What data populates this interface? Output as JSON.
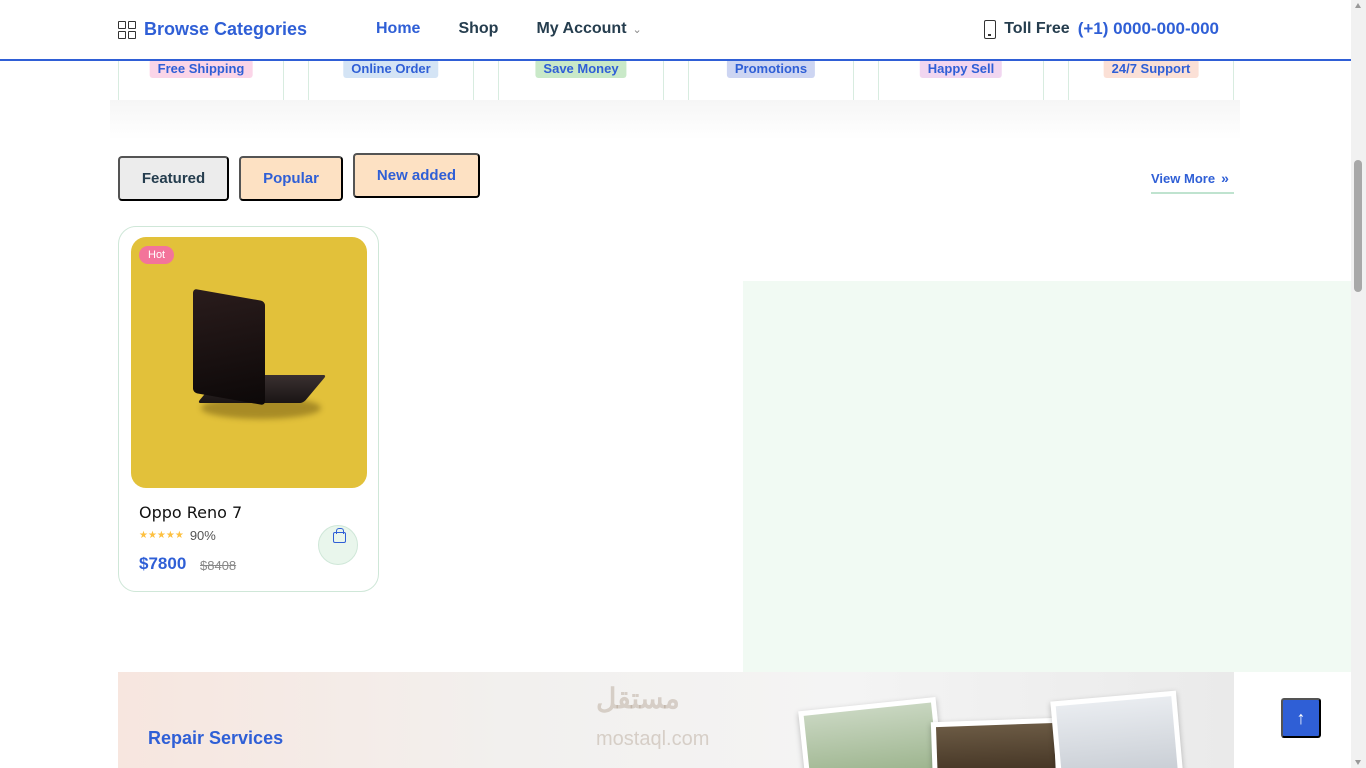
{
  "header": {
    "browse_label": "Browse Categories",
    "nav": [
      {
        "label": "Home"
      },
      {
        "label": "Shop"
      },
      {
        "label": "My Account"
      }
    ],
    "toll_free_label": "Toll Free",
    "toll_free_number": "(+1) 0000-000-000"
  },
  "features": [
    {
      "label": "Free Shipping",
      "color": "#fbd5e8"
    },
    {
      "label": "Online Order",
      "color": "#d4e4f5"
    },
    {
      "label": "Save Money",
      "color": "#c9e9c8"
    },
    {
      "label": "Promotions",
      "color": "#cdd5f2"
    },
    {
      "label": "Happy Sell",
      "color": "#f1d6f0"
    },
    {
      "label": "24/7 Support",
      "color": "#fbe0d6"
    }
  ],
  "tabs": {
    "featured": "Featured",
    "popular": "Popular",
    "new_added": "New added",
    "view_more": "View More"
  },
  "product": {
    "badge": "Hot",
    "name": "Oppo Reno 7",
    "stars": "★★★★★",
    "rating": "90%",
    "price": "$7800",
    "old_price": "$8408"
  },
  "banner": {
    "title": "Repair Services",
    "watermark": "مستقل",
    "watermark_sub": "mostaql.com"
  },
  "colors": {
    "accent": "#2f5fd6",
    "tab_highlight": "#fde1c3",
    "hot_badge": "#f3749a",
    "product_bg": "#e2c13a"
  },
  "icons": {
    "browse": "grid-icon",
    "account_chevron": "chevron-down-icon",
    "phone": "phone-icon",
    "view_more": "double-chevron-right-icon",
    "cart": "add-to-cart-icon",
    "back_to_top": "arrow-up-icon"
  },
  "back_to_top_glyph": "↑"
}
